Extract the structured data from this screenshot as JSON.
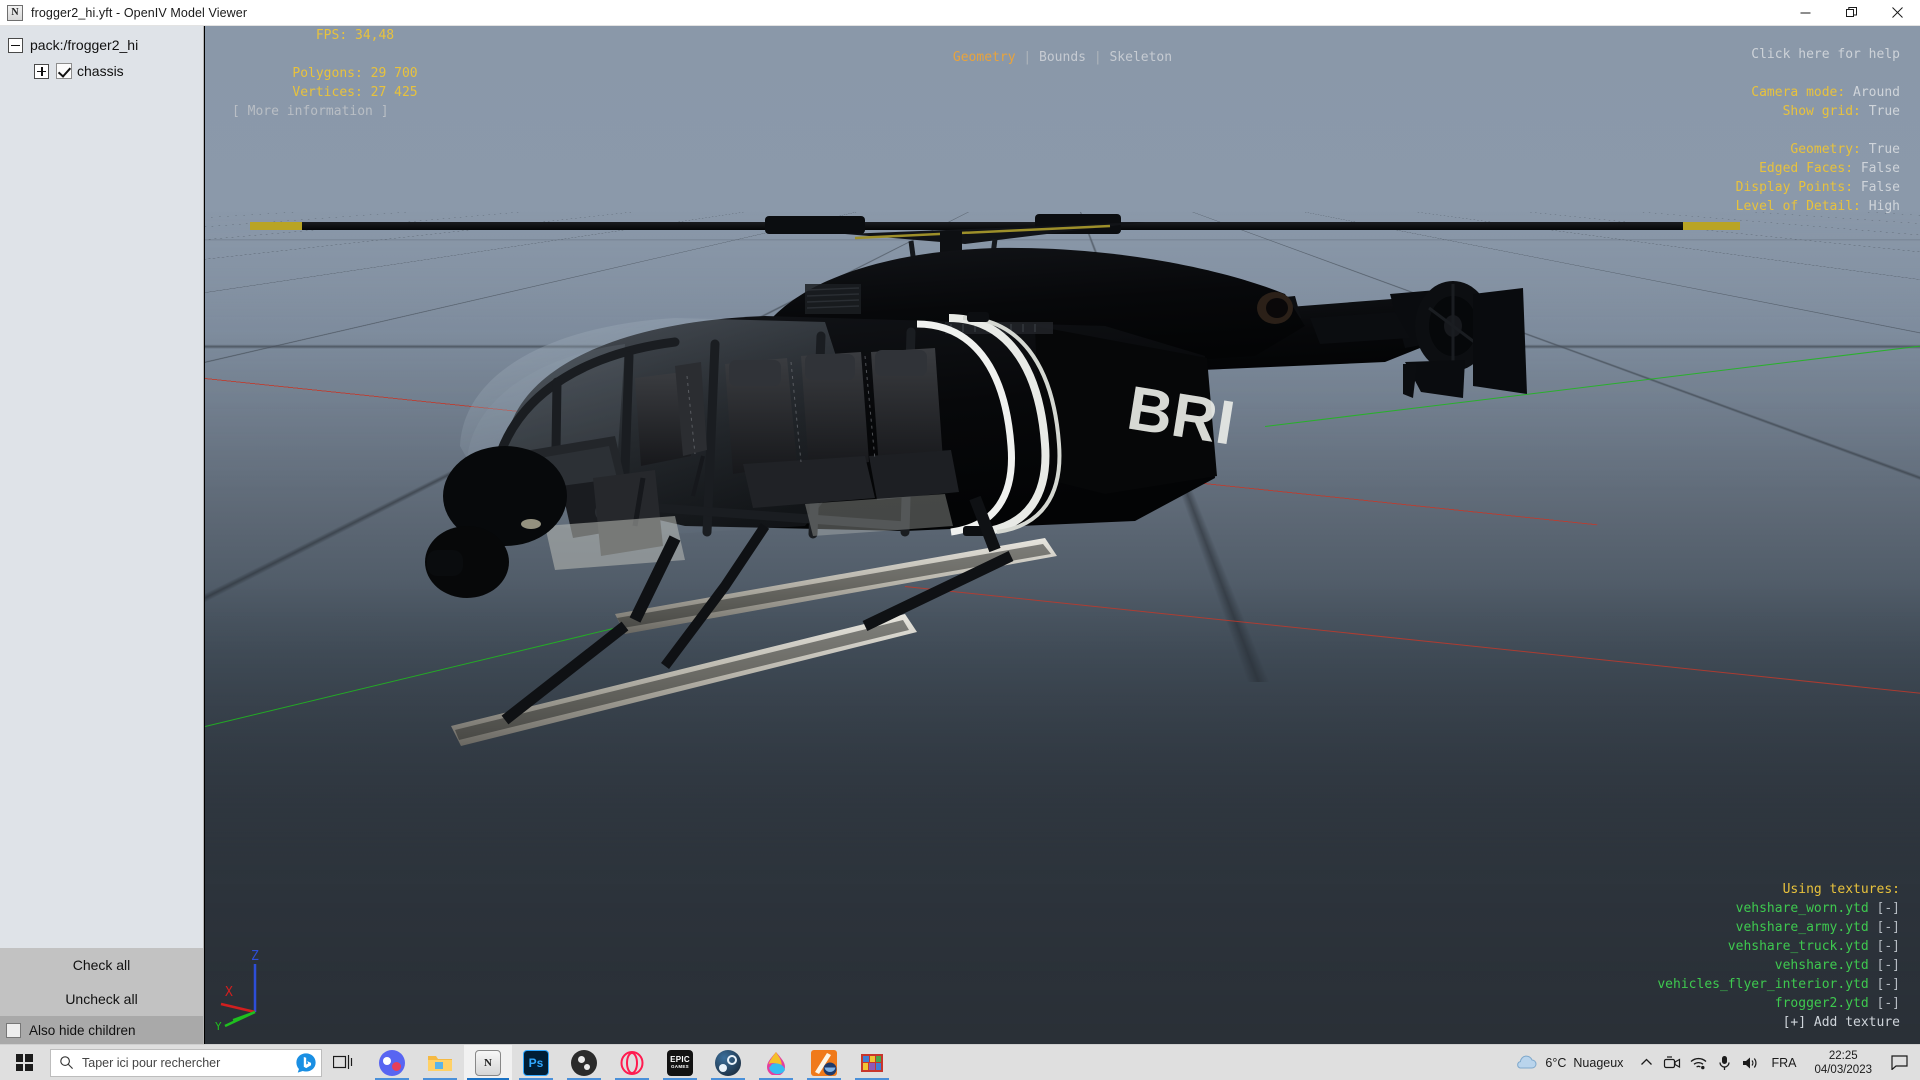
{
  "window": {
    "title": "frogger2_hi.yft - OpenIV Model Viewer",
    "icon": "openiv-icon",
    "minimize_label": "Minimize",
    "maximize_label": "Restore",
    "close_label": "Close"
  },
  "sidebar": {
    "tree": [
      {
        "label": "pack:/frogger2_hi",
        "expanded": true,
        "has_checkbox": false,
        "toggle": "minus"
      },
      {
        "label": "chassis",
        "expanded": false,
        "has_checkbox": true,
        "checked": true,
        "toggle": "plus"
      }
    ],
    "buttons": [
      {
        "label": "Check all",
        "name": "check-all-button"
      },
      {
        "label": "Uncheck all",
        "name": "uncheck-all-button"
      }
    ],
    "hide_children": {
      "label": "Also hide children",
      "checked": false
    }
  },
  "viewport": {
    "stats": {
      "fps_label": "FPS:",
      "fps_value": "34,48",
      "polygons_label": "Polygons:",
      "polygons_value": "29 700",
      "vertices_label": "Vertices:",
      "vertices_value": "27 425",
      "more_information": "[ More information ]"
    },
    "tabs": [
      {
        "label": "Geometry",
        "active": true
      },
      {
        "label": "Bounds",
        "active": false
      },
      {
        "label": "Skeleton",
        "active": false
      }
    ],
    "tab_separator": "|",
    "help": "Click here for help",
    "settings": [
      {
        "label": "Camera mode:",
        "value": "Around"
      },
      {
        "label": "Show grid:",
        "value": "True"
      },
      {
        "label": "Geometry:",
        "value": "True"
      },
      {
        "label": "Edged Faces:",
        "value": "False"
      },
      {
        "label": "Display Points:",
        "value": "False"
      },
      {
        "label": "Level of Detail:",
        "value": "High"
      }
    ],
    "textures": {
      "header": "Using textures:",
      "items": [
        {
          "name": "vehshare_worn.ytd",
          "action": "[-]"
        },
        {
          "name": "vehshare_army.ytd",
          "action": "[-]"
        },
        {
          "name": "vehshare_truck.ytd",
          "action": "[-]"
        },
        {
          "name": "vehshare.ytd",
          "action": "[-]"
        },
        {
          "name": "vehicles_flyer_interior.ytd",
          "action": "[-]"
        },
        {
          "name": "frogger2.ytd",
          "action": "[-]"
        }
      ],
      "add": "[+] Add texture"
    },
    "gizmo": {
      "x": "X",
      "y": "Y",
      "z": "Z"
    },
    "model": {
      "livery_text": "BRI",
      "description": "black police helicopter"
    },
    "colors": {
      "label_yellow": "#e8c23c",
      "value_gray": "#cfd4da",
      "texture_green": "#3ec94f",
      "tab_active": "#e8a33c",
      "axis_x": "#c0392b",
      "axis_y": "#21b521",
      "axis_z": "#2d4ed8"
    }
  },
  "taskbar": {
    "start_label": "Start",
    "search_placeholder": "Taper ici pour rechercher",
    "search_icon": "search-icon",
    "bing_icon": "bing-icon",
    "task_view_label": "Task View",
    "apps": [
      {
        "name": "discord-icon",
        "label": "D"
      },
      {
        "name": "file-explorer-icon",
        "label": ""
      },
      {
        "name": "openiv-icon",
        "label": "N",
        "active": true
      },
      {
        "name": "photoshop-icon",
        "label": "Ps"
      },
      {
        "name": "obs-studio-icon",
        "label": ""
      },
      {
        "name": "opera-gx-icon",
        "label": ""
      },
      {
        "name": "epic-games-icon",
        "label": "EPIC"
      },
      {
        "name": "steam-icon",
        "label": ""
      },
      {
        "name": "paint-3d-icon",
        "label": ""
      },
      {
        "name": "zmodeler-icon",
        "label": ""
      },
      {
        "name": "winrar-icon",
        "label": ""
      }
    ],
    "tray": {
      "weather_temp": "6°C",
      "weather_desc": "Nuageux",
      "show_hidden_label": "Show hidden icons",
      "icons": [
        "meet-now-icon",
        "network-icon",
        "microphone-icon",
        "volume-icon"
      ],
      "language": "FRA",
      "time": "22:25",
      "date": "04/03/2023",
      "notifications_label": "Notifications"
    }
  }
}
